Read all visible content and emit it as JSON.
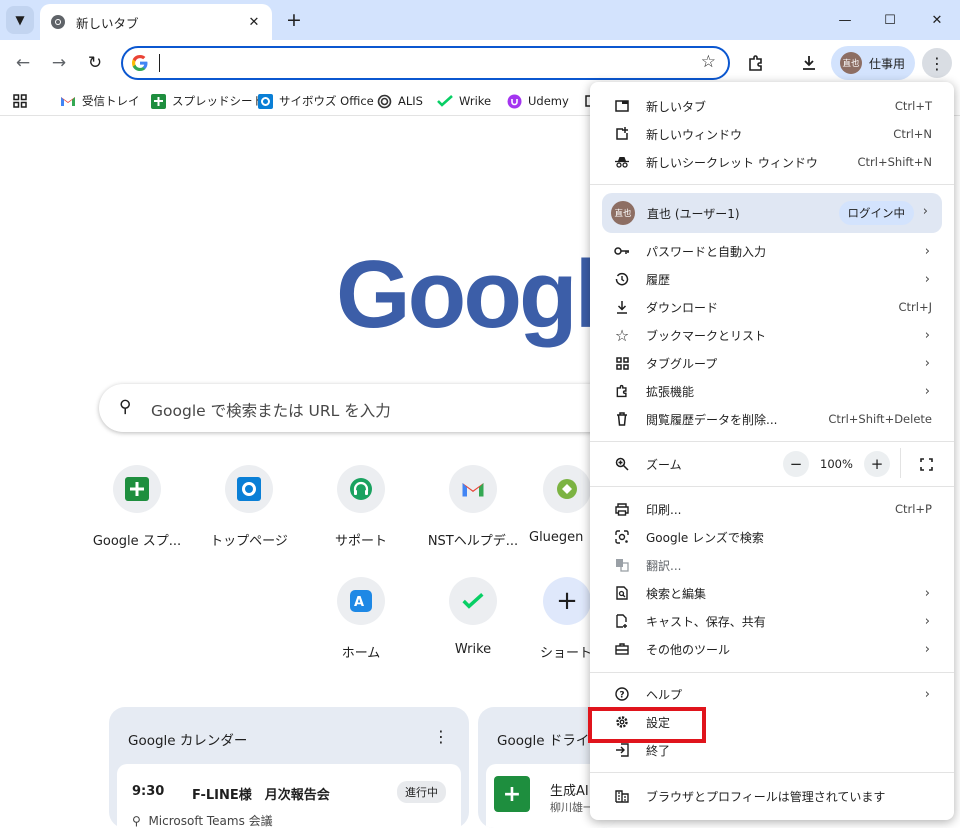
{
  "tab": {
    "title": "新しいタブ"
  },
  "toolbar": {
    "profile_label": "仕事用",
    "avatar_text": "直也"
  },
  "bookmarks": [
    {
      "label": "受信トレイ"
    },
    {
      "label": "スプレッドシート"
    },
    {
      "label": "サイボウズ Office"
    },
    {
      "label": "ALIS"
    },
    {
      "label": "Wrike"
    },
    {
      "label": "Udemy"
    }
  ],
  "ntp": {
    "logo": "Google",
    "search_placeholder": "Google で検索または URL を入力",
    "shortcuts": [
      {
        "label": "Google スプ..."
      },
      {
        "label": "トップページ"
      },
      {
        "label": "サポート"
      },
      {
        "label": "NSTヘルプデ..."
      },
      {
        "label": "Gluegen"
      },
      {
        "label": "ホーム"
      },
      {
        "label": "Wrike"
      },
      {
        "label": "ショート"
      }
    ],
    "calendar": {
      "title": "Google カレンダー",
      "event_time": "9:30",
      "event_name": "F-LINE様　月次報告会",
      "event_status": "進行中",
      "event_location": "Microsoft Teams 会議"
    },
    "drive": {
      "title": "Google ドライブ",
      "file_name": "生成AI",
      "file_sub": "柳川雄一"
    }
  },
  "menu": {
    "items_top": [
      {
        "label": "新しいタブ",
        "shortcut": "Ctrl+T"
      },
      {
        "label": "新しいウィンドウ",
        "shortcut": "Ctrl+N"
      },
      {
        "label": "新しいシークレット ウィンドウ",
        "shortcut": "Ctrl+Shift+N"
      }
    ],
    "profile": {
      "avatar": "直也",
      "name": "直也 (ユーザー1)",
      "status": "ログイン中"
    },
    "items_mid": [
      {
        "label": "パスワードと自動入力",
        "shortcut": ""
      },
      {
        "label": "履歴",
        "shortcut": ""
      },
      {
        "label": "ダウンロード",
        "shortcut": "Ctrl+J"
      },
      {
        "label": "ブックマークとリスト",
        "shortcut": ""
      },
      {
        "label": "タブグループ",
        "shortcut": ""
      },
      {
        "label": "拡張機能",
        "shortcut": ""
      },
      {
        "label": "閲覧履歴データを削除...",
        "shortcut": "Ctrl+Shift+Delete"
      }
    ],
    "zoom": {
      "label": "ズーム",
      "value": "100%",
      "minus": "−",
      "plus": "+"
    },
    "items_tools": [
      {
        "label": "印刷...",
        "shortcut": "Ctrl+P"
      },
      {
        "label": "Google レンズで検索",
        "shortcut": ""
      },
      {
        "label": "翻訳...",
        "shortcut": ""
      },
      {
        "label": "検索と編集",
        "shortcut": ""
      },
      {
        "label": "キャスト、保存、共有",
        "shortcut": ""
      },
      {
        "label": "その他のツール",
        "shortcut": ""
      }
    ],
    "items_bottom": [
      {
        "label": "ヘルプ"
      },
      {
        "label": "設定"
      },
      {
        "label": "終了"
      }
    ],
    "managed": "ブラウザとプロフィールは管理されています"
  }
}
